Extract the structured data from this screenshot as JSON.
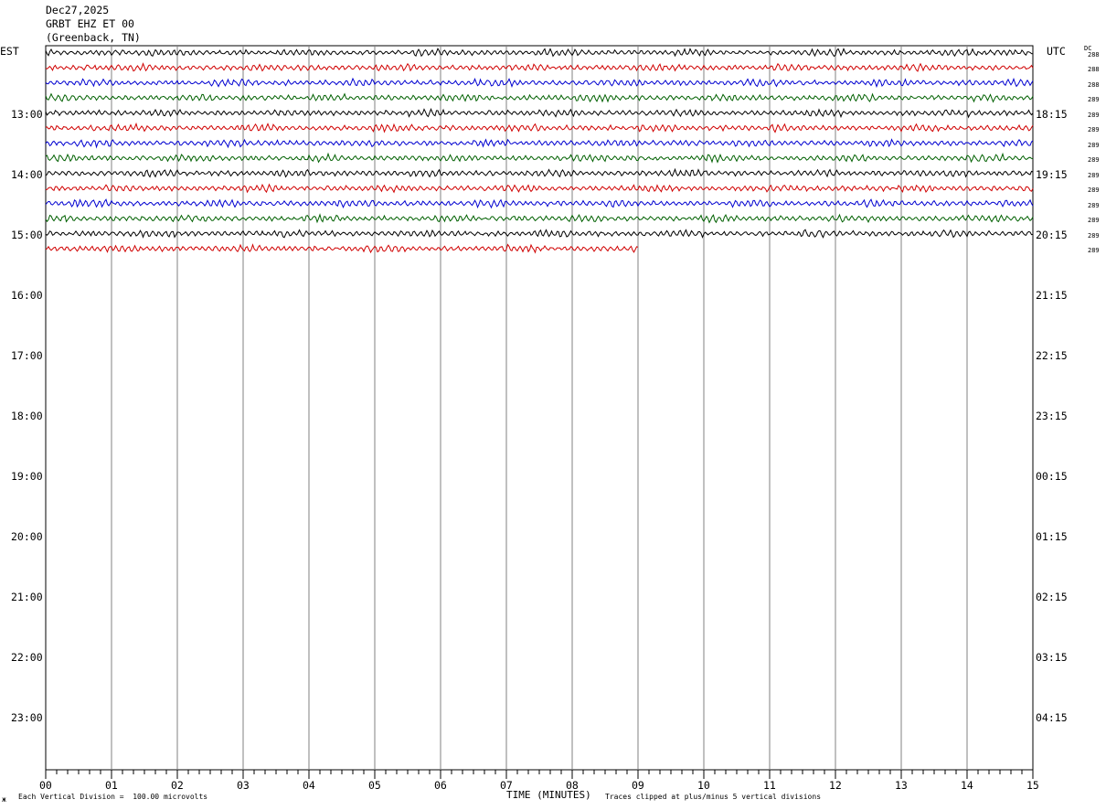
{
  "header": {
    "date": "Dec27,2025",
    "station": "GRBT EHZ ET 00",
    "location": "(Greenback, TN)"
  },
  "left_tz": "EST",
  "right_tz": "UTC",
  "dc_label": "DC",
  "footer": {
    "scale_note": "Each Vertical Division =  100.00 microvolts",
    "xlabel": "TIME (MINUTES)",
    "clip_note": "Traces clipped at plus/minus 5 vertical divisions",
    "corner_mark": "ж"
  },
  "chart_data": {
    "type": "line",
    "xlabel": "TIME (MINUTES)",
    "xlim": [
      0,
      15
    ],
    "x_ticks": [
      "00",
      "01",
      "02",
      "03",
      "04",
      "05",
      "06",
      "07",
      "08",
      "09",
      "10",
      "11",
      "12",
      "13",
      "14",
      "15"
    ],
    "left_hour_labels": [
      "13:00",
      "14:00",
      "15:00",
      "16:00",
      "17:00",
      "18:00",
      "19:00",
      "20:00",
      "21:00",
      "22:00",
      "23:00"
    ],
    "right_hour_labels": [
      "18:15",
      "19:15",
      "20:15",
      "21:15",
      "22:15",
      "23:15",
      "00:15",
      "01:15",
      "02:15",
      "03:15",
      "04:15"
    ],
    "trace_colors": [
      "#000000",
      "#d00000",
      "#0000d0",
      "#006000"
    ],
    "rows": [
      {
        "dc": "288",
        "color": "#000000",
        "end_minute": 15
      },
      {
        "dc": "288",
        "color": "#d00000",
        "end_minute": 15
      },
      {
        "dc": "288",
        "color": "#0000d0",
        "end_minute": 15
      },
      {
        "dc": "289",
        "color": "#006000",
        "end_minute": 15
      },
      {
        "dc": "289",
        "color": "#000000",
        "end_minute": 15
      },
      {
        "dc": "289",
        "color": "#d00000",
        "end_minute": 15
      },
      {
        "dc": "289",
        "color": "#0000d0",
        "end_minute": 15
      },
      {
        "dc": "289",
        "color": "#006000",
        "end_minute": 15
      },
      {
        "dc": "289",
        "color": "#000000",
        "end_minute": 15
      },
      {
        "dc": "289",
        "color": "#d00000",
        "end_minute": 15
      },
      {
        "dc": "289",
        "color": "#0000d0",
        "end_minute": 15
      },
      {
        "dc": "289",
        "color": "#006000",
        "end_minute": 15
      },
      {
        "dc": "289",
        "color": "#000000",
        "end_minute": 15
      },
      {
        "dc": "289",
        "color": "#d00000",
        "end_minute": 9
      }
    ]
  }
}
